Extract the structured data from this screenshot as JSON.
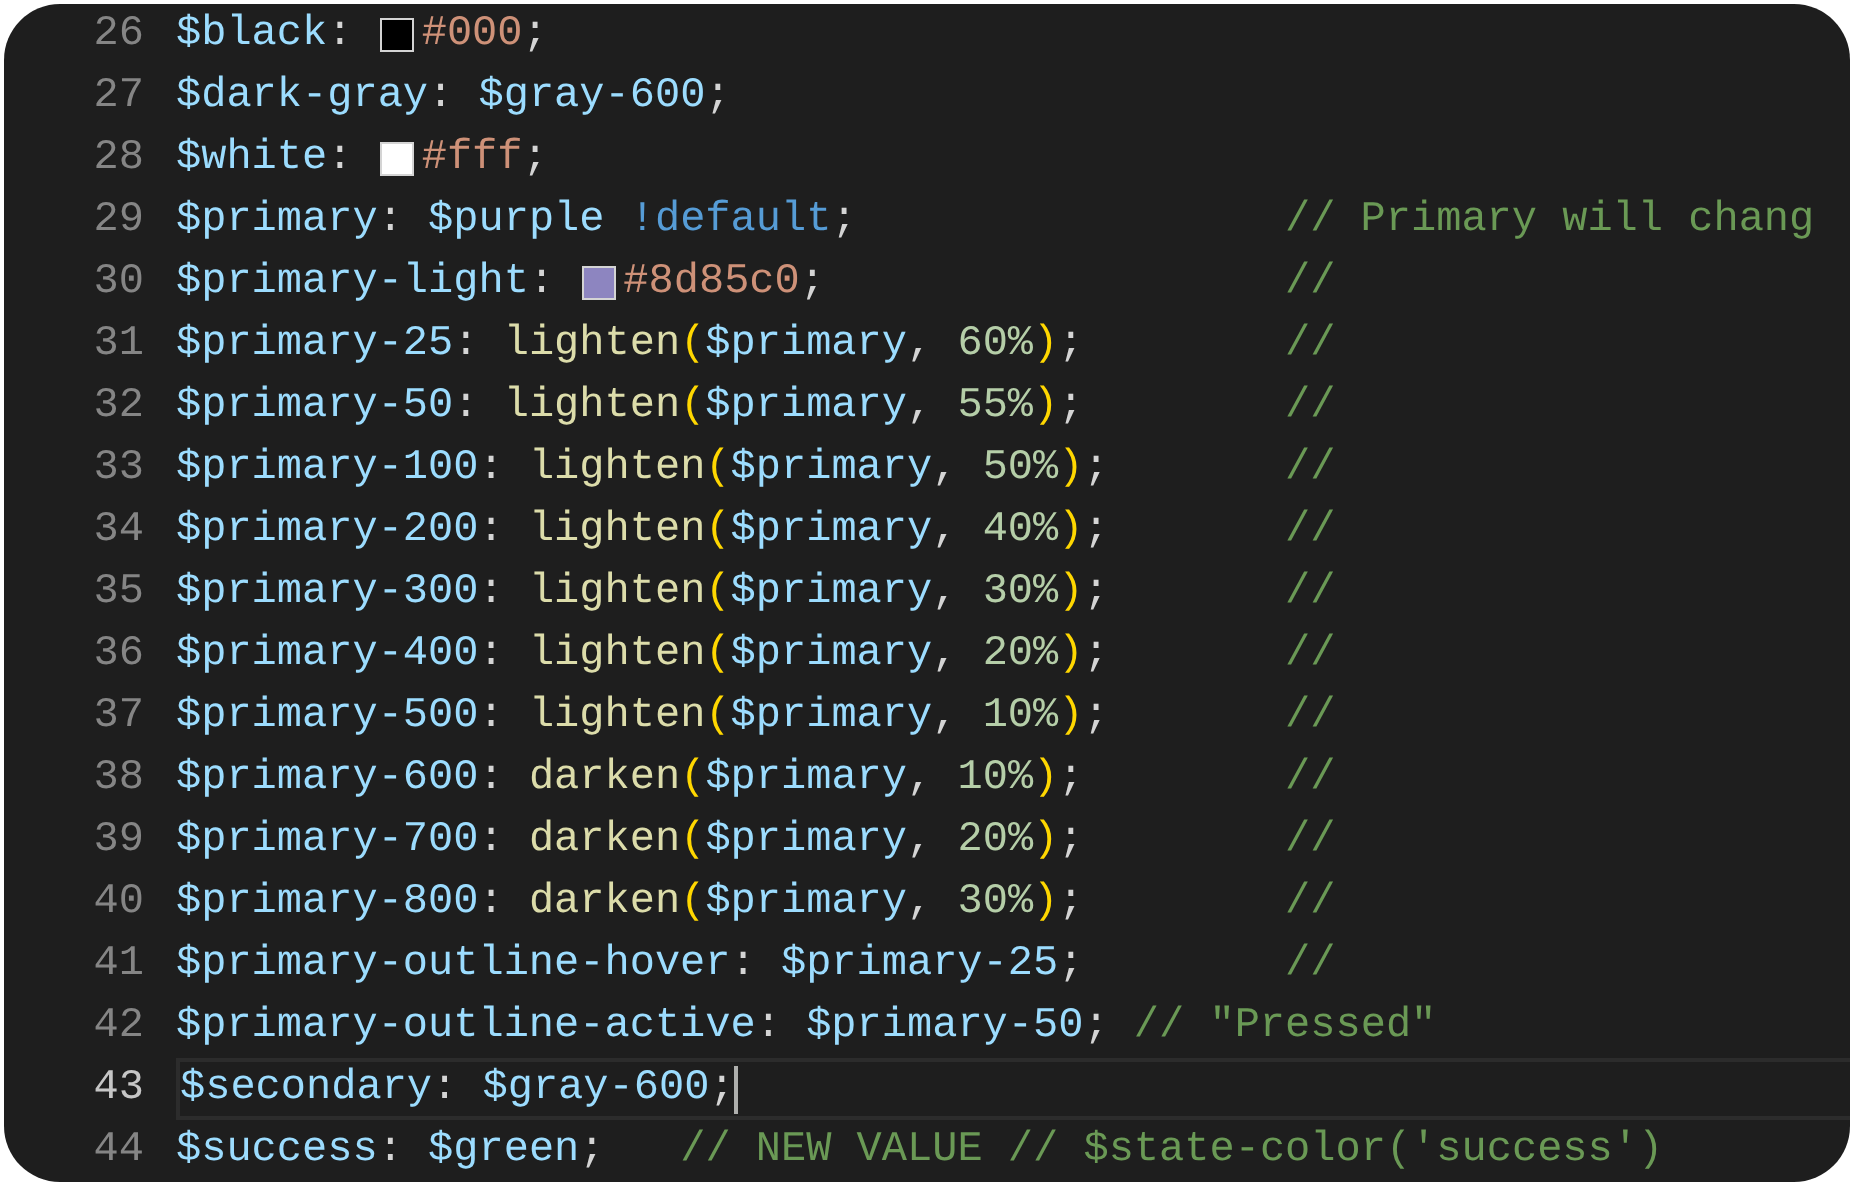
{
  "lines": [
    {
      "number": "26",
      "current": false,
      "code": [
        {
          "text": "$black",
          "kind": "variable"
        },
        {
          "text": ": ",
          "kind": "punct"
        },
        {
          "kind": "swatch",
          "color": "#000000"
        },
        {
          "text": "#000",
          "kind": "hex"
        },
        {
          "text": ";",
          "kind": "punct"
        }
      ]
    },
    {
      "number": "27",
      "current": false,
      "code": [
        {
          "text": "$dark-gray",
          "kind": "variable"
        },
        {
          "text": ": ",
          "kind": "punct"
        },
        {
          "text": "$gray-600",
          "kind": "variable"
        },
        {
          "text": ";",
          "kind": "punct"
        }
      ]
    },
    {
      "number": "28",
      "current": false,
      "code": [
        {
          "text": "$white",
          "kind": "variable"
        },
        {
          "text": ": ",
          "kind": "punct"
        },
        {
          "kind": "swatch",
          "color": "#ffffff"
        },
        {
          "text": "#fff",
          "kind": "hex"
        },
        {
          "text": ";",
          "kind": "punct"
        }
      ]
    },
    {
      "number": "29",
      "current": false,
      "code": [
        {
          "text": "$primary",
          "kind": "variable"
        },
        {
          "text": ": ",
          "kind": "punct"
        },
        {
          "text": "$purple ",
          "kind": "variable"
        },
        {
          "text": "!default",
          "kind": "keyword"
        },
        {
          "text": ";",
          "kind": "punct"
        }
      ],
      "comment": {
        "text": "// Primary will chang",
        "aligned": true
      }
    },
    {
      "number": "30",
      "current": false,
      "code": [
        {
          "text": "$primary-light",
          "kind": "variable"
        },
        {
          "text": ": ",
          "kind": "punct"
        },
        {
          "kind": "swatch",
          "color": "#8d85c0"
        },
        {
          "text": "#8d85c0",
          "kind": "hex"
        },
        {
          "text": ";",
          "kind": "punct"
        }
      ],
      "comment": {
        "text": "//",
        "aligned": true
      }
    },
    {
      "number": "31",
      "current": false,
      "code": [
        {
          "text": "$primary-25",
          "kind": "variable"
        },
        {
          "text": ": ",
          "kind": "punct"
        },
        {
          "text": "lighten",
          "kind": "function"
        },
        {
          "text": "(",
          "kind": "paren"
        },
        {
          "text": "$primary",
          "kind": "variable"
        },
        {
          "text": ", ",
          "kind": "punct"
        },
        {
          "text": "60%",
          "kind": "number"
        },
        {
          "text": ")",
          "kind": "paren"
        },
        {
          "text": ";",
          "kind": "punct"
        }
      ],
      "comment": {
        "text": "//",
        "aligned": true
      }
    },
    {
      "number": "32",
      "current": false,
      "code": [
        {
          "text": "$primary-50",
          "kind": "variable"
        },
        {
          "text": ": ",
          "kind": "punct"
        },
        {
          "text": "lighten",
          "kind": "function"
        },
        {
          "text": "(",
          "kind": "paren"
        },
        {
          "text": "$primary",
          "kind": "variable"
        },
        {
          "text": ", ",
          "kind": "punct"
        },
        {
          "text": "55%",
          "kind": "number"
        },
        {
          "text": ")",
          "kind": "paren"
        },
        {
          "text": ";",
          "kind": "punct"
        }
      ],
      "comment": {
        "text": "//",
        "aligned": true
      }
    },
    {
      "number": "33",
      "current": false,
      "code": [
        {
          "text": "$primary-100",
          "kind": "variable"
        },
        {
          "text": ": ",
          "kind": "punct"
        },
        {
          "text": "lighten",
          "kind": "function"
        },
        {
          "text": "(",
          "kind": "paren"
        },
        {
          "text": "$primary",
          "kind": "variable"
        },
        {
          "text": ", ",
          "kind": "punct"
        },
        {
          "text": "50%",
          "kind": "number"
        },
        {
          "text": ")",
          "kind": "paren"
        },
        {
          "text": ";",
          "kind": "punct"
        }
      ],
      "comment": {
        "text": "//",
        "aligned": true
      }
    },
    {
      "number": "34",
      "current": false,
      "code": [
        {
          "text": "$primary-200",
          "kind": "variable"
        },
        {
          "text": ": ",
          "kind": "punct"
        },
        {
          "text": "lighten",
          "kind": "function"
        },
        {
          "text": "(",
          "kind": "paren"
        },
        {
          "text": "$primary",
          "kind": "variable"
        },
        {
          "text": ", ",
          "kind": "punct"
        },
        {
          "text": "40%",
          "kind": "number"
        },
        {
          "text": ")",
          "kind": "paren"
        },
        {
          "text": ";",
          "kind": "punct"
        }
      ],
      "comment": {
        "text": "//",
        "aligned": true
      }
    },
    {
      "number": "35",
      "current": false,
      "code": [
        {
          "text": "$primary-300",
          "kind": "variable"
        },
        {
          "text": ": ",
          "kind": "punct"
        },
        {
          "text": "lighten",
          "kind": "function"
        },
        {
          "text": "(",
          "kind": "paren"
        },
        {
          "text": "$primary",
          "kind": "variable"
        },
        {
          "text": ", ",
          "kind": "punct"
        },
        {
          "text": "30%",
          "kind": "number"
        },
        {
          "text": ")",
          "kind": "paren"
        },
        {
          "text": ";",
          "kind": "punct"
        }
      ],
      "comment": {
        "text": "//",
        "aligned": true
      }
    },
    {
      "number": "36",
      "current": false,
      "code": [
        {
          "text": "$primary-400",
          "kind": "variable"
        },
        {
          "text": ": ",
          "kind": "punct"
        },
        {
          "text": "lighten",
          "kind": "function"
        },
        {
          "text": "(",
          "kind": "paren"
        },
        {
          "text": "$primary",
          "kind": "variable"
        },
        {
          "text": ", ",
          "kind": "punct"
        },
        {
          "text": "20%",
          "kind": "number"
        },
        {
          "text": ")",
          "kind": "paren"
        },
        {
          "text": ";",
          "kind": "punct"
        }
      ],
      "comment": {
        "text": "//",
        "aligned": true
      }
    },
    {
      "number": "37",
      "current": false,
      "code": [
        {
          "text": "$primary-500",
          "kind": "variable"
        },
        {
          "text": ": ",
          "kind": "punct"
        },
        {
          "text": "lighten",
          "kind": "function"
        },
        {
          "text": "(",
          "kind": "paren"
        },
        {
          "text": "$primary",
          "kind": "variable"
        },
        {
          "text": ", ",
          "kind": "punct"
        },
        {
          "text": "10%",
          "kind": "number"
        },
        {
          "text": ")",
          "kind": "paren"
        },
        {
          "text": ";",
          "kind": "punct"
        }
      ],
      "comment": {
        "text": "//",
        "aligned": true
      }
    },
    {
      "number": "38",
      "current": false,
      "code": [
        {
          "text": "$primary-600",
          "kind": "variable"
        },
        {
          "text": ": ",
          "kind": "punct"
        },
        {
          "text": "darken",
          "kind": "function"
        },
        {
          "text": "(",
          "kind": "paren"
        },
        {
          "text": "$primary",
          "kind": "variable"
        },
        {
          "text": ", ",
          "kind": "punct"
        },
        {
          "text": "10%",
          "kind": "number"
        },
        {
          "text": ")",
          "kind": "paren"
        },
        {
          "text": ";",
          "kind": "punct"
        }
      ],
      "comment": {
        "text": "//",
        "aligned": true
      }
    },
    {
      "number": "39",
      "current": false,
      "code": [
        {
          "text": "$primary-700",
          "kind": "variable"
        },
        {
          "text": ": ",
          "kind": "punct"
        },
        {
          "text": "darken",
          "kind": "function"
        },
        {
          "text": "(",
          "kind": "paren"
        },
        {
          "text": "$primary",
          "kind": "variable"
        },
        {
          "text": ", ",
          "kind": "punct"
        },
        {
          "text": "20%",
          "kind": "number"
        },
        {
          "text": ")",
          "kind": "paren"
        },
        {
          "text": ";",
          "kind": "punct"
        }
      ],
      "comment": {
        "text": "//",
        "aligned": true
      }
    },
    {
      "number": "40",
      "current": false,
      "code": [
        {
          "text": "$primary-800",
          "kind": "variable"
        },
        {
          "text": ": ",
          "kind": "punct"
        },
        {
          "text": "darken",
          "kind": "function"
        },
        {
          "text": "(",
          "kind": "paren"
        },
        {
          "text": "$primary",
          "kind": "variable"
        },
        {
          "text": ", ",
          "kind": "punct"
        },
        {
          "text": "30%",
          "kind": "number"
        },
        {
          "text": ")",
          "kind": "paren"
        },
        {
          "text": ";",
          "kind": "punct"
        }
      ],
      "comment": {
        "text": "//",
        "aligned": true
      }
    },
    {
      "number": "41",
      "current": false,
      "code": [
        {
          "text": "$primary-outline-hover",
          "kind": "variable"
        },
        {
          "text": ": ",
          "kind": "punct"
        },
        {
          "text": "$primary-25",
          "kind": "variable"
        },
        {
          "text": ";",
          "kind": "punct"
        }
      ],
      "comment": {
        "text": "//",
        "aligned": true
      }
    },
    {
      "number": "42",
      "current": false,
      "code": [
        {
          "text": "$primary-outline-active",
          "kind": "variable"
        },
        {
          "text": ": ",
          "kind": "punct"
        },
        {
          "text": "$primary-50",
          "kind": "variable"
        },
        {
          "text": "; ",
          "kind": "punct"
        }
      ],
      "comment": {
        "text": "// \"Pressed\"",
        "aligned": false
      }
    },
    {
      "number": "43",
      "current": true,
      "code": [
        {
          "text": "$secondary",
          "kind": "variable"
        },
        {
          "text": ": ",
          "kind": "punct"
        },
        {
          "text": "$gray-600",
          "kind": "variable"
        },
        {
          "text": ";",
          "kind": "punct"
        }
      ]
    },
    {
      "number": "44",
      "current": false,
      "code": [
        {
          "text": "$success",
          "kind": "variable"
        },
        {
          "text": ": ",
          "kind": "punct"
        },
        {
          "text": "$green",
          "kind": "variable"
        },
        {
          "text": ";   ",
          "kind": "punct"
        }
      ],
      "comment": {
        "text": "// NEW VALUE // $state-color('success')",
        "aligned": false
      }
    }
  ]
}
